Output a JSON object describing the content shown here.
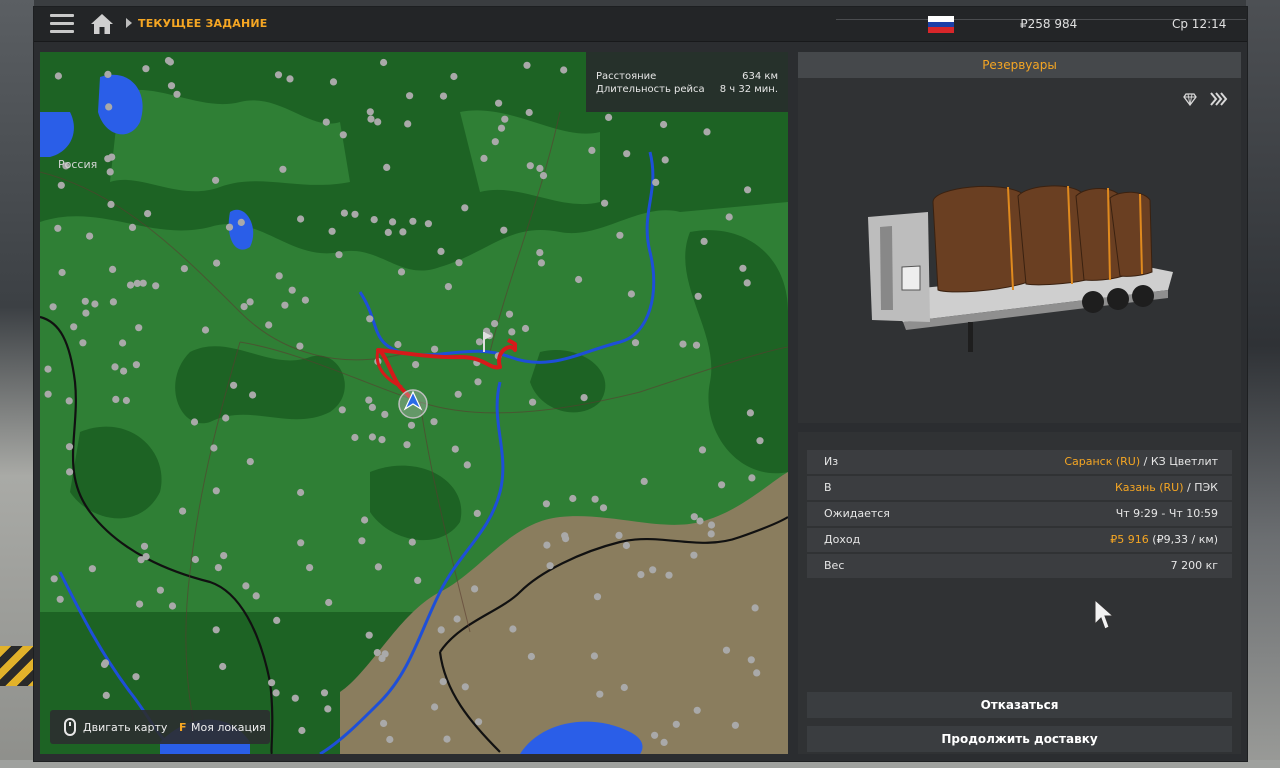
{
  "topbar": {
    "breadcrumb": "ТЕКУЩЕЕ ЗАДАНИЕ",
    "money": "₽258 984",
    "clock": "Ср 12:14",
    "flag_colors": [
      "#ffffff",
      "#1c3fa8",
      "#d8262a"
    ]
  },
  "map": {
    "info": {
      "distance_label": "Расстояние",
      "distance_value": "634 км",
      "duration_label": "Длительность рейса",
      "duration_value": "8 ч 32 мин."
    },
    "country_label": "Россия",
    "hints": {
      "move_map": "Двигать карту",
      "location_key": "F",
      "my_location": "Моя локация"
    },
    "colors": {
      "forest": "#1d6324",
      "field": "#2f7f35",
      "water": "#2a5ee8",
      "route": "#d61a1a",
      "steppe": "#8a7d5e"
    }
  },
  "cargo": {
    "title": "Резервуары",
    "icons": [
      "gem-icon",
      "fast-forward-icon"
    ]
  },
  "details": {
    "from_label": "Из",
    "from_city": "Саранск (RU)",
    "from_company": " / КЗ Цветлит",
    "to_label": "В",
    "to_city": "Казань (RU)",
    "to_company": " / ПЭК",
    "expected_label": "Ожидается",
    "expected_value": "Чт 9:29 - Чт 10:59",
    "income_label": "Доход",
    "income_value": "₽5 916",
    "income_rate": " (₽9,33 / км)",
    "weight_label": "Вес",
    "weight_value": "7 200 кг"
  },
  "buttons": {
    "decline": "Отказаться",
    "continue": "Продолжить доставку"
  }
}
